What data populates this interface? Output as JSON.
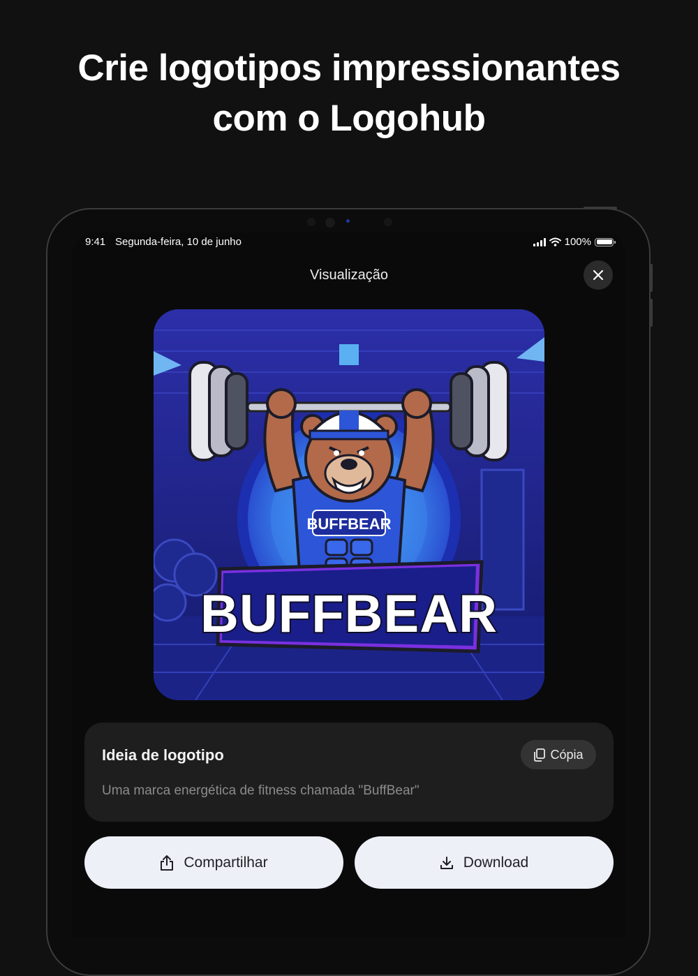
{
  "headline": {
    "line1": "Crie logotipos impressionantes",
    "line2": "com o Logohub"
  },
  "status_bar": {
    "time": "9:41",
    "date": "Segunda-feira, 10 de junho",
    "battery": "100%"
  },
  "nav": {
    "title": "Visualização",
    "close_icon": "close-icon"
  },
  "logo": {
    "badge_text": "BUFFBEAR",
    "banner_text": "BUFFBEAR"
  },
  "idea_card": {
    "title": "Ideia de logotipo",
    "copy_label": "Cópia",
    "description": "Uma marca energética de fitness chamada \"BuffBear\""
  },
  "actions": {
    "share_label": "Compartilhar",
    "download_label": "Download"
  },
  "colors": {
    "background": "#111111",
    "screen": "#0a0a0a",
    "card": "#1e1e1e",
    "button": "#eef0f7",
    "logo_blue": "#2f3fd0"
  }
}
